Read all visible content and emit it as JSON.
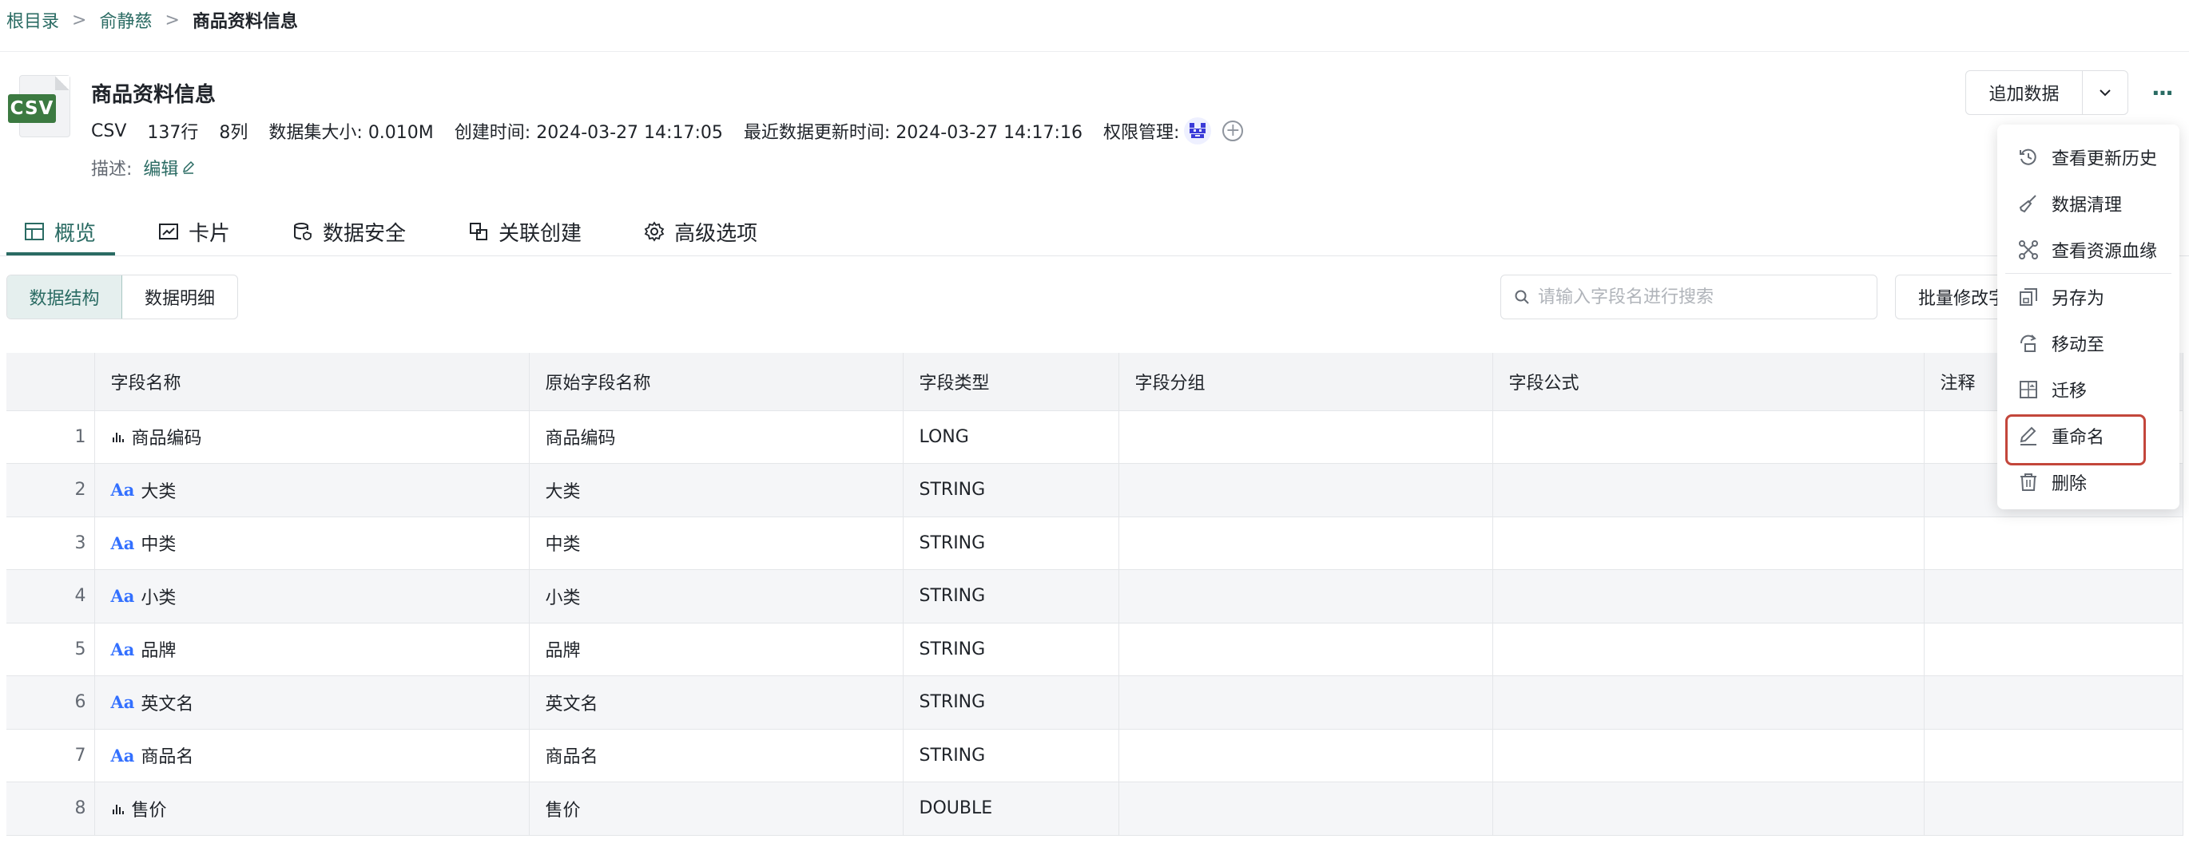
{
  "breadcrumb": {
    "root": "根目录",
    "sep": ">",
    "folder": "俞静慈",
    "current": "商品资料信息"
  },
  "dataset": {
    "type_badge": "CSV",
    "title": "商品资料信息",
    "meta": {
      "type": "CSV",
      "rows": "137行",
      "cols": "8列",
      "size_label": "数据集大小:",
      "size": "0.010M",
      "created_label": "创建时间:",
      "created": "2024-03-27 14:17:05",
      "updated_label": "最近数据更新时间:",
      "updated": "2024-03-27 14:17:16",
      "perm_label": "权限管理:"
    },
    "desc_label": "描述:",
    "desc_edit": "编辑"
  },
  "actions": {
    "append": "追加数据",
    "more": "···"
  },
  "tabs": [
    {
      "label": "概览",
      "icon": "table-icon"
    },
    {
      "label": "卡片",
      "icon": "chart-card-icon"
    },
    {
      "label": "数据安全",
      "icon": "shield-db-icon"
    },
    {
      "label": "关联创建",
      "icon": "link-icon"
    },
    {
      "label": "高级选项",
      "icon": "gear-icon"
    }
  ],
  "segments": [
    "数据结构",
    "数据明细"
  ],
  "search": {
    "placeholder": "请输入字段名进行搜索"
  },
  "batch_button": "批量修改字段",
  "table": {
    "headers": [
      "字段名称",
      "原始字段名称",
      "字段类型",
      "字段分组",
      "字段公式",
      "注释"
    ],
    "rows": [
      {
        "idx": "1",
        "kind": "number",
        "name": "商品编码",
        "orig": "商品编码",
        "type": "LONG"
      },
      {
        "idx": "2",
        "kind": "string",
        "name": "大类",
        "orig": "大类",
        "type": "STRING"
      },
      {
        "idx": "3",
        "kind": "string",
        "name": "中类",
        "orig": "中类",
        "type": "STRING"
      },
      {
        "idx": "4",
        "kind": "string",
        "name": "小类",
        "orig": "小类",
        "type": "STRING"
      },
      {
        "idx": "5",
        "kind": "string",
        "name": "品牌",
        "orig": "品牌",
        "type": "STRING"
      },
      {
        "idx": "6",
        "kind": "string",
        "name": "英文名",
        "orig": "英文名",
        "type": "STRING"
      },
      {
        "idx": "7",
        "kind": "string",
        "name": "商品名",
        "orig": "商品名",
        "type": "STRING"
      },
      {
        "idx": "8",
        "kind": "number",
        "name": "售价",
        "orig": "售价",
        "type": "DOUBLE"
      }
    ],
    "string_icon": "Aa"
  },
  "menu": {
    "items": [
      {
        "label": "查看更新历史",
        "icon": "history-icon"
      },
      {
        "label": "数据清理",
        "icon": "broom-icon"
      },
      {
        "label": "查看资源血缘",
        "icon": "lineage-icon"
      },
      {
        "label": "另存为",
        "icon": "save-as-icon"
      },
      {
        "label": "移动至",
        "icon": "move-icon"
      },
      {
        "label": "迁移",
        "icon": "migrate-icon"
      },
      {
        "label": "重命名",
        "icon": "rename-icon",
        "highlighted": true
      },
      {
        "label": "删除",
        "icon": "trash-icon"
      }
    ]
  },
  "colors": {
    "accent": "#2a6b63",
    "string_icon": "#3370ff",
    "highlight_box": "#c3463b",
    "csv_badge": "#3c7a41"
  }
}
